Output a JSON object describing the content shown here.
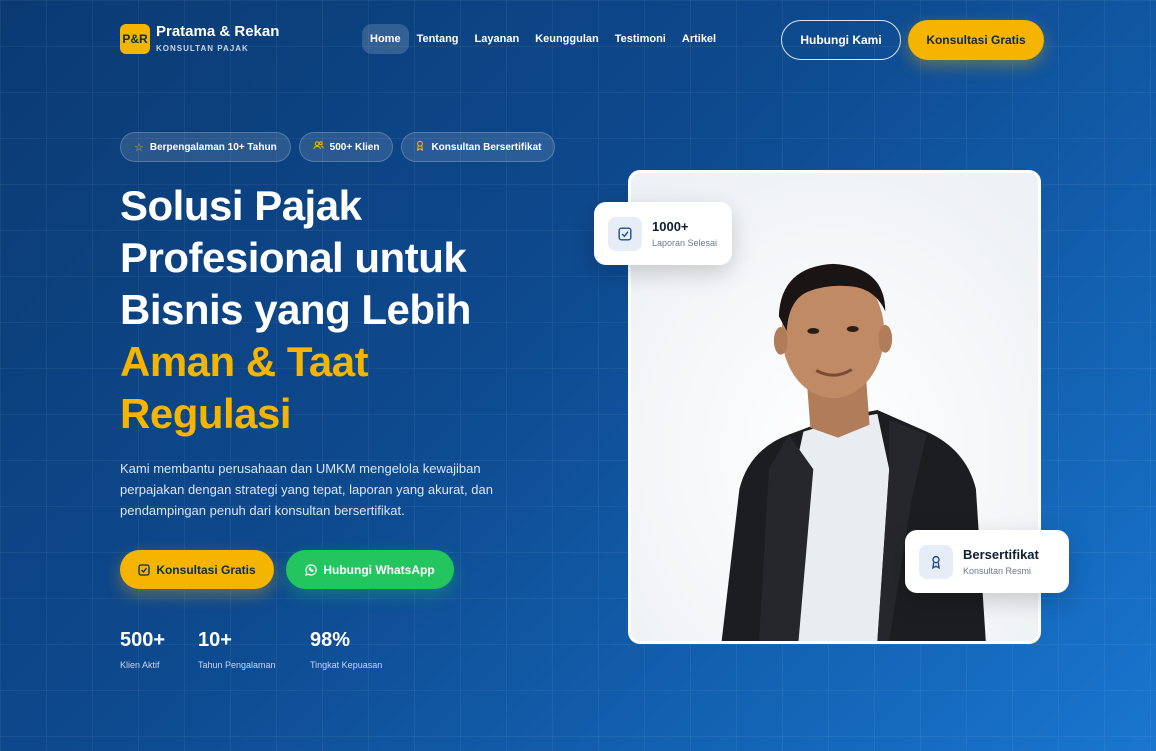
{
  "brand": {
    "mark": "P&R",
    "name": "Pratama & Rekan",
    "tagline": "KONSULTAN PAJAK"
  },
  "nav": {
    "items": [
      {
        "label": "Home",
        "active": true
      },
      {
        "label": "Tentang"
      },
      {
        "label": "Layanan"
      },
      {
        "label": "Keunggulan"
      },
      {
        "label": "Testimoni"
      },
      {
        "label": "Artikel"
      }
    ],
    "contact_label": "Hubungi Kami",
    "consult_label": "Konsultasi Gratis"
  },
  "badges": [
    {
      "icon": "star-icon",
      "label": "Berpengalaman 10+ Tahun"
    },
    {
      "icon": "users-icon",
      "label": "500+ Klien"
    },
    {
      "icon": "award-icon",
      "label": "Konsultan Bersertifikat"
    }
  ],
  "hero": {
    "title_line1": "Solusi Pajak",
    "title_line2": "Profesional untuk",
    "title_line3": "Bisnis yang Lebih",
    "title_highlight1": "Aman & Taat",
    "title_highlight2": "Regulasi",
    "description": "Kami membantu perusahaan dan UMKM mengelola kewajiban perpajakan dengan strategi yang tepat, laporan yang akurat, dan pendampingan penuh dari konsultan bersertifikat.",
    "cta_primary": "Konsultasi Gratis",
    "cta_whatsapp": "Hubungi WhatsApp"
  },
  "stats": [
    {
      "value": "500+",
      "label": "Klien Aktif"
    },
    {
      "value": "10+",
      "label": "Tahun Pengalaman"
    },
    {
      "value": "98%",
      "label": "Tingkat Kepuasan"
    }
  ],
  "float_cards": {
    "reports": {
      "value": "1000+",
      "label": "Laporan Selesai",
      "icon": "check-square-icon"
    },
    "certified": {
      "value": "Bersertifikat",
      "label": "Konsultan Resmi",
      "icon": "award-icon"
    }
  },
  "colors": {
    "accent": "#f5b400",
    "whatsapp": "#22c55e",
    "bg": "#0e4a8f"
  }
}
